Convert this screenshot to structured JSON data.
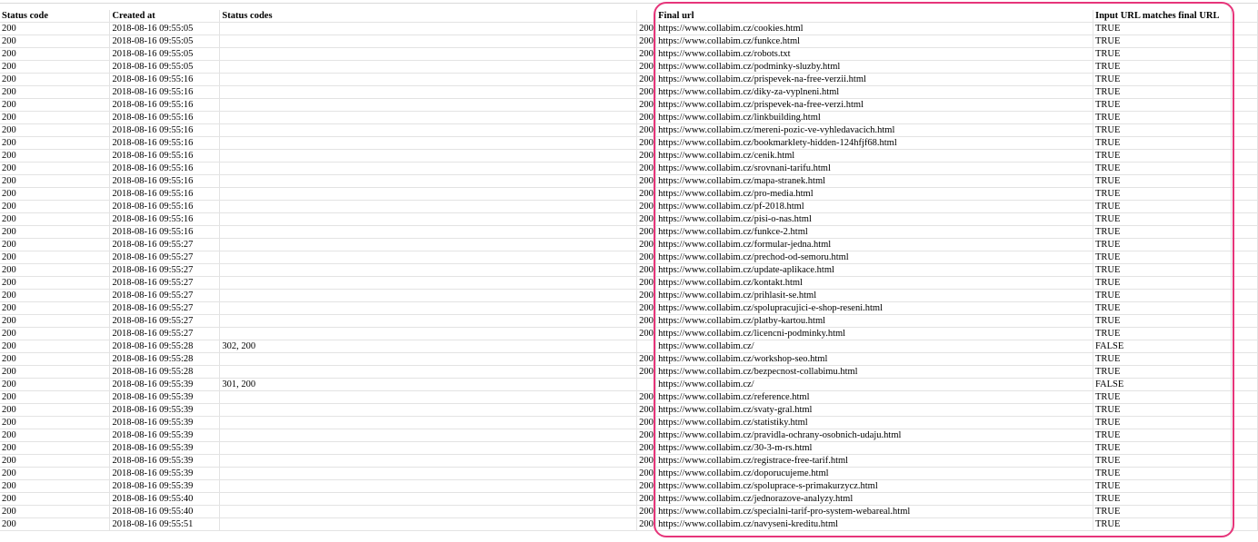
{
  "headers": {
    "status_code": "Status code",
    "created_at": "Created at",
    "status_codes": "Status codes",
    "final_url": "Final url",
    "match": "Input URL matches final URL"
  },
  "rows": [
    {
      "status_code": "200",
      "created_at": "2018-08-16 09:55:05",
      "status_codes": "",
      "final_num": "200",
      "final_url": "https://www.collabim.cz/cookies.html",
      "match": "TRUE"
    },
    {
      "status_code": "200",
      "created_at": "2018-08-16 09:55:05",
      "status_codes": "",
      "final_num": "200",
      "final_url": "https://www.collabim.cz/funkce.html",
      "match": "TRUE"
    },
    {
      "status_code": "200",
      "created_at": "2018-08-16 09:55:05",
      "status_codes": "",
      "final_num": "200",
      "final_url": "https://www.collabim.cz/robots.txt",
      "match": "TRUE"
    },
    {
      "status_code": "200",
      "created_at": "2018-08-16 09:55:05",
      "status_codes": "",
      "final_num": "200",
      "final_url": "https://www.collabim.cz/podminky-sluzby.html",
      "match": "TRUE"
    },
    {
      "status_code": "200",
      "created_at": "2018-08-16 09:55:16",
      "status_codes": "",
      "final_num": "200",
      "final_url": "https://www.collabim.cz/prispevek-na-free-verzii.html",
      "match": "TRUE"
    },
    {
      "status_code": "200",
      "created_at": "2018-08-16 09:55:16",
      "status_codes": "",
      "final_num": "200",
      "final_url": "https://www.collabim.cz/diky-za-vyplneni.html",
      "match": "TRUE"
    },
    {
      "status_code": "200",
      "created_at": "2018-08-16 09:55:16",
      "status_codes": "",
      "final_num": "200",
      "final_url": "https://www.collabim.cz/prispevek-na-free-verzi.html",
      "match": "TRUE"
    },
    {
      "status_code": "200",
      "created_at": "2018-08-16 09:55:16",
      "status_codes": "",
      "final_num": "200",
      "final_url": "https://www.collabim.cz/linkbuilding.html",
      "match": "TRUE"
    },
    {
      "status_code": "200",
      "created_at": "2018-08-16 09:55:16",
      "status_codes": "",
      "final_num": "200",
      "final_url": "https://www.collabim.cz/mereni-pozic-ve-vyhledavacich.html",
      "match": "TRUE"
    },
    {
      "status_code": "200",
      "created_at": "2018-08-16 09:55:16",
      "status_codes": "",
      "final_num": "200",
      "final_url": "https://www.collabim.cz/bookmarklety-hidden-124hfjf68.html",
      "match": "TRUE"
    },
    {
      "status_code": "200",
      "created_at": "2018-08-16 09:55:16",
      "status_codes": "",
      "final_num": "200",
      "final_url": "https://www.collabim.cz/cenik.html",
      "match": "TRUE"
    },
    {
      "status_code": "200",
      "created_at": "2018-08-16 09:55:16",
      "status_codes": "",
      "final_num": "200",
      "final_url": "https://www.collabim.cz/srovnani-tarifu.html",
      "match": "TRUE"
    },
    {
      "status_code": "200",
      "created_at": "2018-08-16 09:55:16",
      "status_codes": "",
      "final_num": "200",
      "final_url": "https://www.collabim.cz/mapa-stranek.html",
      "match": "TRUE"
    },
    {
      "status_code": "200",
      "created_at": "2018-08-16 09:55:16",
      "status_codes": "",
      "final_num": "200",
      "final_url": "https://www.collabim.cz/pro-media.html",
      "match": "TRUE"
    },
    {
      "status_code": "200",
      "created_at": "2018-08-16 09:55:16",
      "status_codes": "",
      "final_num": "200",
      "final_url": "https://www.collabim.cz/pf-2018.html",
      "match": "TRUE"
    },
    {
      "status_code": "200",
      "created_at": "2018-08-16 09:55:16",
      "status_codes": "",
      "final_num": "200",
      "final_url": "https://www.collabim.cz/pisi-o-nas.html",
      "match": "TRUE"
    },
    {
      "status_code": "200",
      "created_at": "2018-08-16 09:55:16",
      "status_codes": "",
      "final_num": "200",
      "final_url": "https://www.collabim.cz/funkce-2.html",
      "match": "TRUE"
    },
    {
      "status_code": "200",
      "created_at": "2018-08-16 09:55:27",
      "status_codes": "",
      "final_num": "200",
      "final_url": "https://www.collabim.cz/formular-jedna.html",
      "match": "TRUE"
    },
    {
      "status_code": "200",
      "created_at": "2018-08-16 09:55:27",
      "status_codes": "",
      "final_num": "200",
      "final_url": "https://www.collabim.cz/prechod-od-semoru.html",
      "match": "TRUE"
    },
    {
      "status_code": "200",
      "created_at": "2018-08-16 09:55:27",
      "status_codes": "",
      "final_num": "200",
      "final_url": "https://www.collabim.cz/update-aplikace.html",
      "match": "TRUE"
    },
    {
      "status_code": "200",
      "created_at": "2018-08-16 09:55:27",
      "status_codes": "",
      "final_num": "200",
      "final_url": "https://www.collabim.cz/kontakt.html",
      "match": "TRUE"
    },
    {
      "status_code": "200",
      "created_at": "2018-08-16 09:55:27",
      "status_codes": "",
      "final_num": "200",
      "final_url": "https://www.collabim.cz/prihlasit-se.html",
      "match": "TRUE"
    },
    {
      "status_code": "200",
      "created_at": "2018-08-16 09:55:27",
      "status_codes": "",
      "final_num": "200",
      "final_url": "https://www.collabim.cz/spolupracujici-e-shop-reseni.html",
      "match": "TRUE"
    },
    {
      "status_code": "200",
      "created_at": "2018-08-16 09:55:27",
      "status_codes": "",
      "final_num": "200",
      "final_url": "https://www.collabim.cz/platby-kartou.html",
      "match": "TRUE"
    },
    {
      "status_code": "200",
      "created_at": "2018-08-16 09:55:27",
      "status_codes": "",
      "final_num": "200",
      "final_url": "https://www.collabim.cz/licencni-podminky.html",
      "match": "TRUE"
    },
    {
      "status_code": "200",
      "created_at": "2018-08-16 09:55:28",
      "status_codes": "302, 200",
      "final_num": "",
      "final_url": "https://www.collabim.cz/",
      "match": "FALSE"
    },
    {
      "status_code": "200",
      "created_at": "2018-08-16 09:55:28",
      "status_codes": "",
      "final_num": "200",
      "final_url": "https://www.collabim.cz/workshop-seo.html",
      "match": "TRUE"
    },
    {
      "status_code": "200",
      "created_at": "2018-08-16 09:55:28",
      "status_codes": "",
      "final_num": "200",
      "final_url": "https://www.collabim.cz/bezpecnost-collabimu.html",
      "match": "TRUE"
    },
    {
      "status_code": "200",
      "created_at": "2018-08-16 09:55:39",
      "status_codes": "301, 200",
      "final_num": "",
      "final_url": "https://www.collabim.cz/",
      "match": "FALSE"
    },
    {
      "status_code": "200",
      "created_at": "2018-08-16 09:55:39",
      "status_codes": "",
      "final_num": "200",
      "final_url": "https://www.collabim.cz/reference.html",
      "match": "TRUE"
    },
    {
      "status_code": "200",
      "created_at": "2018-08-16 09:55:39",
      "status_codes": "",
      "final_num": "200",
      "final_url": "https://www.collabim.cz/svaty-gral.html",
      "match": "TRUE"
    },
    {
      "status_code": "200",
      "created_at": "2018-08-16 09:55:39",
      "status_codes": "",
      "final_num": "200",
      "final_url": "https://www.collabim.cz/statistiky.html",
      "match": "TRUE"
    },
    {
      "status_code": "200",
      "created_at": "2018-08-16 09:55:39",
      "status_codes": "",
      "final_num": "200",
      "final_url": "https://www.collabim.cz/pravidla-ochrany-osobnich-udaju.html",
      "match": "TRUE"
    },
    {
      "status_code": "200",
      "created_at": "2018-08-16 09:55:39",
      "status_codes": "",
      "final_num": "200",
      "final_url": "https://www.collabim.cz/30-3-m-rs.html",
      "match": "TRUE"
    },
    {
      "status_code": "200",
      "created_at": "2018-08-16 09:55:39",
      "status_codes": "",
      "final_num": "200",
      "final_url": "https://www.collabim.cz/registrace-free-tarif.html",
      "match": "TRUE"
    },
    {
      "status_code": "200",
      "created_at": "2018-08-16 09:55:39",
      "status_codes": "",
      "final_num": "200",
      "final_url": "https://www.collabim.cz/doporucujeme.html",
      "match": "TRUE"
    },
    {
      "status_code": "200",
      "created_at": "2018-08-16 09:55:39",
      "status_codes": "",
      "final_num": "200",
      "final_url": "https://www.collabim.cz/spoluprace-s-primakurzycz.html",
      "match": "TRUE"
    },
    {
      "status_code": "200",
      "created_at": "2018-08-16 09:55:40",
      "status_codes": "",
      "final_num": "200",
      "final_url": "https://www.collabim.cz/jednorazove-analyzy.html",
      "match": "TRUE"
    },
    {
      "status_code": "200",
      "created_at": "2018-08-16 09:55:40",
      "status_codes": "",
      "final_num": "200",
      "final_url": "https://www.collabim.cz/specialni-tarif-pro-system-webareal.html",
      "match": "TRUE"
    },
    {
      "status_code": "200",
      "created_at": "2018-08-16 09:55:51",
      "status_codes": "",
      "final_num": "200",
      "final_url": "https://www.collabim.cz/navyseni-kreditu.html",
      "match": "TRUE"
    }
  ]
}
